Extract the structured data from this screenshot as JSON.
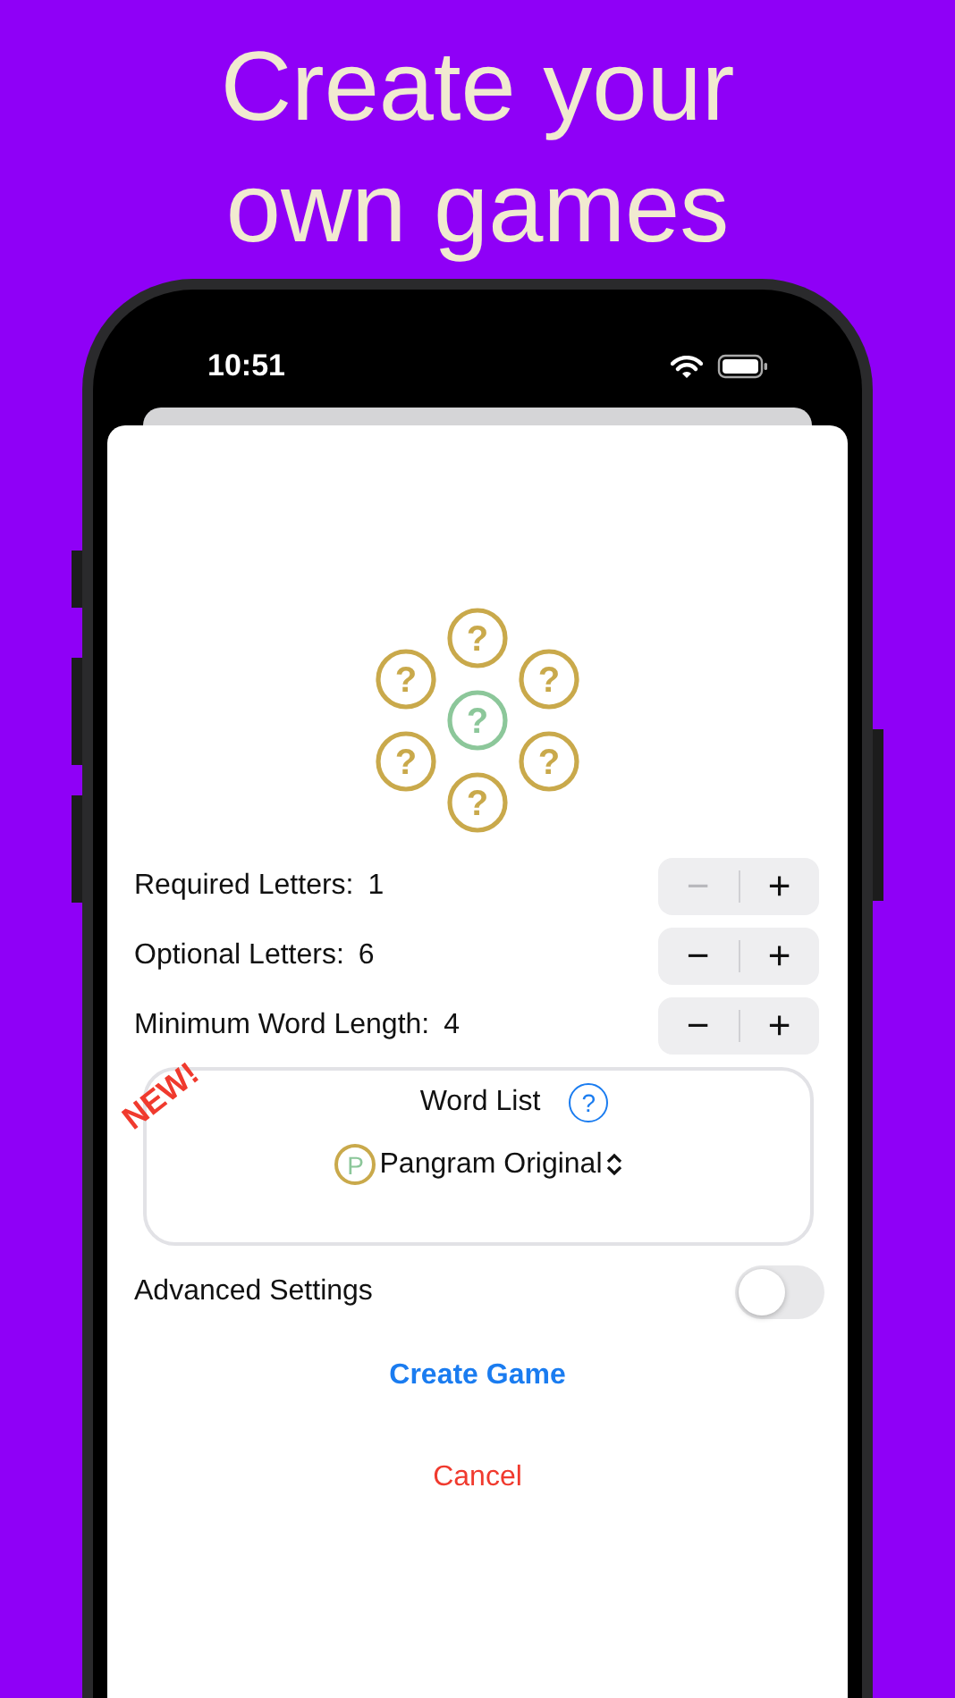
{
  "headline": "Create your own games",
  "status_bar": {
    "time": "10:51"
  },
  "letters": [
    {
      "kind": "optional",
      "text": "?"
    },
    {
      "kind": "optional",
      "text": "?"
    },
    {
      "kind": "optional",
      "text": "?"
    },
    {
      "kind": "required",
      "text": "?"
    },
    {
      "kind": "optional",
      "text": "?"
    },
    {
      "kind": "optional",
      "text": "?"
    },
    {
      "kind": "optional",
      "text": "?"
    }
  ],
  "settings": [
    {
      "label": "Required Letters:",
      "value": "1",
      "minus_disabled": true,
      "minus": "−",
      "plus": "+"
    },
    {
      "label": "Optional Letters:",
      "value": "6",
      "minus_disabled": false,
      "minus": "−",
      "plus": "+"
    },
    {
      "label": "Minimum Word Length:",
      "value": "4",
      "minus_disabled": false,
      "minus": "−",
      "plus": "+"
    }
  ],
  "word_list": {
    "badge": "NEW!",
    "title": "Word List",
    "help": "?",
    "badge_letter": "P",
    "selection": "Pangram Original"
  },
  "advanced": {
    "label": "Advanced Settings",
    "on": false
  },
  "create_button": "Create Game",
  "cancel_button": "Cancel"
}
